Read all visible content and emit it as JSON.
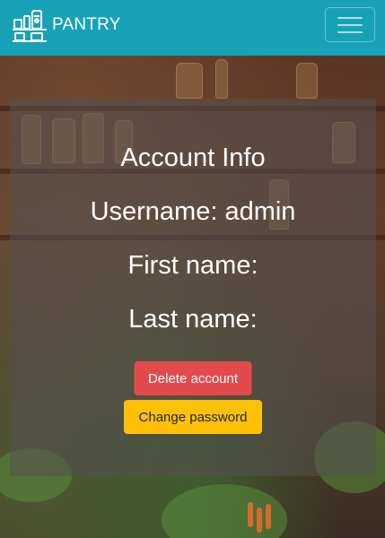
{
  "navbar": {
    "brand_text": "PANTRY",
    "brand_icon": "pantry-shelf-icon",
    "toggler_icon": "hamburger-menu-icon",
    "background_color": "#17a2b8"
  },
  "account": {
    "heading": "Account Info",
    "username_line": "Username: admin",
    "first_name_line": "First name:",
    "last_name_line": "Last name:"
  },
  "buttons": {
    "delete_label": "Delete account",
    "change_password_label": "Change password",
    "delete_color": "#e34a4e",
    "change_password_color": "#ffc107"
  }
}
